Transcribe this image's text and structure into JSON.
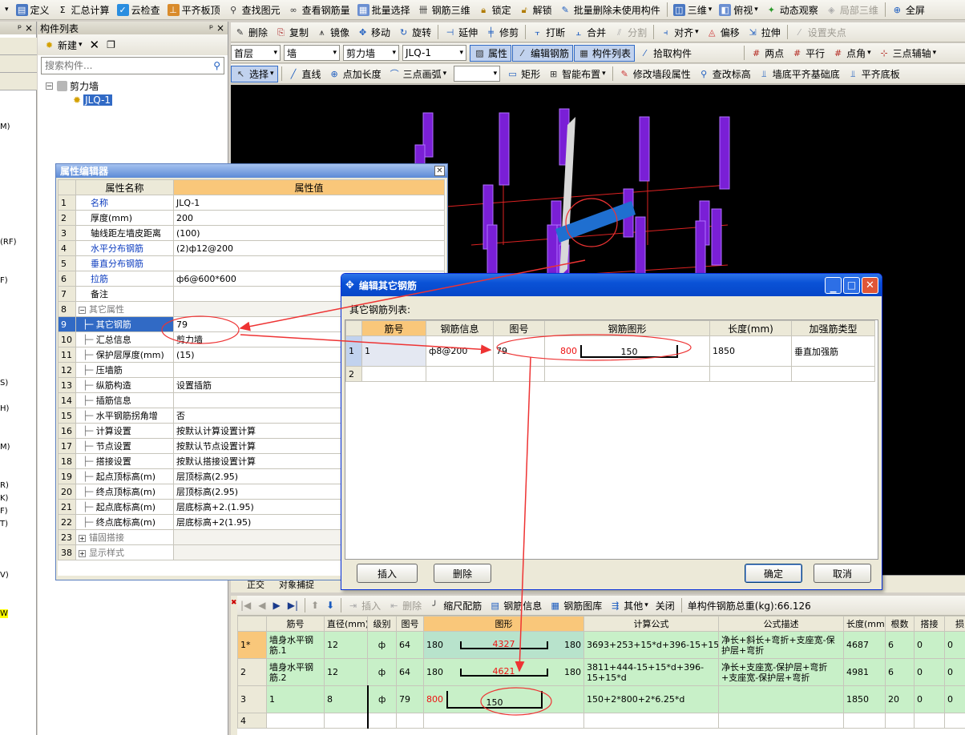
{
  "toolbar1": [
    "定义",
    "汇总计算",
    "云检查",
    "平齐板顶",
    "查找图元",
    "查看钢筋量",
    "批量选择",
    "钢筋三维",
    "锁定",
    "解锁",
    "批量删除未使用构件",
    "三维",
    "俯视",
    "动态观察",
    "局部三维",
    "全屏"
  ],
  "toolbar2": [
    "删除",
    "复制",
    "镜像",
    "移动",
    "旋转",
    "延伸",
    "修剪",
    "打断",
    "合并",
    "分割",
    "对齐",
    "偏移",
    "拉伸",
    "设置夹点"
  ],
  "toolbar3": {
    "floor": "首层",
    "type": "墙",
    "sub": "剪力墙",
    "comp": "JLQ-1",
    "buttons": [
      "属性",
      "编辑钢筋",
      "构件列表",
      "拾取构件"
    ],
    "right": [
      "两点",
      "平行",
      "点角",
      "三点辅轴"
    ]
  },
  "toolbar4": [
    "选择",
    "直线",
    "点加长度",
    "三点画弧",
    "矩形",
    "智能布置",
    "修改墙段属性",
    "查改标高",
    "墙底平齐基础底",
    "平齐底板"
  ],
  "comp_panel": {
    "title": "构件列表",
    "new_label": "新建",
    "search_placeholder": "搜索构件...",
    "tree_root": "剪力墙",
    "tree_child": "JLQ-1"
  },
  "left_stub": [
    "M)",
    "(RF)",
    "F)",
    "S)",
    "H)",
    "M)",
    "R)",
    "K)",
    "F)",
    "T)",
    "V)",
    "W"
  ],
  "prop_editor": {
    "title": "属性编辑器",
    "col_name": "属性名称",
    "col_value": "属性值",
    "rows": [
      {
        "n": "1",
        "name": "名称",
        "value": "JLQ-1",
        "style": "blue"
      },
      {
        "n": "2",
        "name": "厚度(mm)",
        "value": "200",
        "style": ""
      },
      {
        "n": "3",
        "name": "轴线距左墙皮距离",
        "value": "(100)",
        "style": ""
      },
      {
        "n": "4",
        "name": "水平分布钢筋",
        "value": "(2)ф12@200",
        "style": "blue"
      },
      {
        "n": "5",
        "name": "垂直分布钢筋",
        "value": "",
        "style": "blue"
      },
      {
        "n": "6",
        "name": "拉筋",
        "value": "ф6@600*600",
        "style": "blue"
      },
      {
        "n": "7",
        "name": "备注",
        "value": "",
        "style": ""
      },
      {
        "n": "8",
        "name": "其它属性",
        "value": "",
        "style": "group"
      },
      {
        "n": "9",
        "name": "其它钢筋",
        "value": "79",
        "style": "sel"
      },
      {
        "n": "10",
        "name": "汇总信息",
        "value": "剪力墙",
        "style": "sub"
      },
      {
        "n": "11",
        "name": "保护层厚度(mm)",
        "value": "(15)",
        "style": "sub"
      },
      {
        "n": "12",
        "name": "压墙筋",
        "value": "",
        "style": "sub"
      },
      {
        "n": "13",
        "name": "纵筋构造",
        "value": "设置插筋",
        "style": "sub"
      },
      {
        "n": "14",
        "name": "插筋信息",
        "value": "",
        "style": "sub"
      },
      {
        "n": "15",
        "name": "水平钢筋拐角增",
        "value": "否",
        "style": "sub"
      },
      {
        "n": "16",
        "name": "计算设置",
        "value": "按默认计算设置计算",
        "style": "sub"
      },
      {
        "n": "17",
        "name": "节点设置",
        "value": "按默认节点设置计算",
        "style": "sub"
      },
      {
        "n": "18",
        "name": "搭接设置",
        "value": "按默认搭接设置计算",
        "style": "sub"
      },
      {
        "n": "19",
        "name": "起点顶标高(m)",
        "value": "层顶标高(2.95)",
        "style": "sub"
      },
      {
        "n": "20",
        "name": "终点顶标高(m)",
        "value": "层顶标高(2.95)",
        "style": "sub"
      },
      {
        "n": "21",
        "name": "起点底标高(m)",
        "value": "层底标高+2.(1.95)",
        "style": "sub"
      },
      {
        "n": "22",
        "name": "终点底标高(m)",
        "value": "层底标高+2(1.95)",
        "style": "sub"
      },
      {
        "n": "23",
        "name": "锚固搭接",
        "value": "",
        "style": "group"
      },
      {
        "n": "38",
        "name": "显示样式",
        "value": "",
        "style": "group"
      }
    ]
  },
  "dialog": {
    "title": "编辑其它钢筋",
    "list_label": "其它钢筋列表:",
    "headers": [
      "筋号",
      "钢筋信息",
      "图号",
      "钢筋图形",
      "长度(mm)",
      "加强筋类型"
    ],
    "row1": {
      "n": "1",
      "jh": "1",
      "info": "ф8@200",
      "tuhao": "79",
      "shape_left": "800",
      "shape_mid": "150",
      "length": "1850",
      "type": "垂直加强筋"
    },
    "row2": {
      "n": "2"
    },
    "insert": "插入",
    "delete": "删除",
    "ok": "确定",
    "cancel": "取消"
  },
  "bottom_tabs": [
    "正交",
    "对象捕捉"
  ],
  "rebar_toolbar": {
    "items": [
      "插入",
      "删除",
      "缩尺配筋",
      "钢筋信息",
      "钢筋图库",
      "其他",
      "关闭"
    ],
    "total": "单构件钢筋总重(kg):66.126"
  },
  "rebar_table": {
    "headers": [
      "筋号",
      "直径(mm)",
      "级别",
      "图号",
      "图形",
      "计算公式",
      "公式描述",
      "长度(mm)",
      "根数",
      "搭接",
      "损"
    ],
    "rows": [
      {
        "n": "1*",
        "jh": "墙身水平钢筋.1",
        "d": "12",
        "lv": "ф",
        "th": "64",
        "l": "180",
        "m": "4327",
        "r": "180",
        "f": "3693+253+15*d+396-15+15*d",
        "desc": "净长+斜长+弯折+支座宽-保护层+弯折",
        "len": "4687",
        "cnt": "6",
        "dj": "0",
        "s": "0"
      },
      {
        "n": "2",
        "jh": "墙身水平钢筋.2",
        "d": "12",
        "lv": "ф",
        "th": "64",
        "l": "180",
        "m": "4621",
        "r": "180",
        "f": "3811+444-15+15*d+396-15+15*d",
        "desc": "净长+支座宽-保护层+弯折+支座宽-保护层+弯折",
        "len": "4981",
        "cnt": "6",
        "dj": "0",
        "s": "0"
      },
      {
        "n": "3",
        "jh": "1",
        "d": "8",
        "lv": "ф",
        "th": "79",
        "l": "800",
        "m": "150",
        "r": "",
        "f": "150+2*800+2*6.25*d",
        "desc": "",
        "len": "1850",
        "cnt": "20",
        "dj": "0",
        "s": "0"
      },
      {
        "n": "4",
        "jh": "",
        "d": "",
        "lv": "",
        "th": "",
        "l": "",
        "m": "",
        "r": "",
        "f": "",
        "desc": "",
        "len": "",
        "cnt": "",
        "dj": "",
        "s": ""
      }
    ]
  },
  "colors": {
    "accent": "#316ac5",
    "viewport": "#000000",
    "green_row": "#c8f0c8",
    "red": "#e11111",
    "purple": "#7a1fd6"
  }
}
